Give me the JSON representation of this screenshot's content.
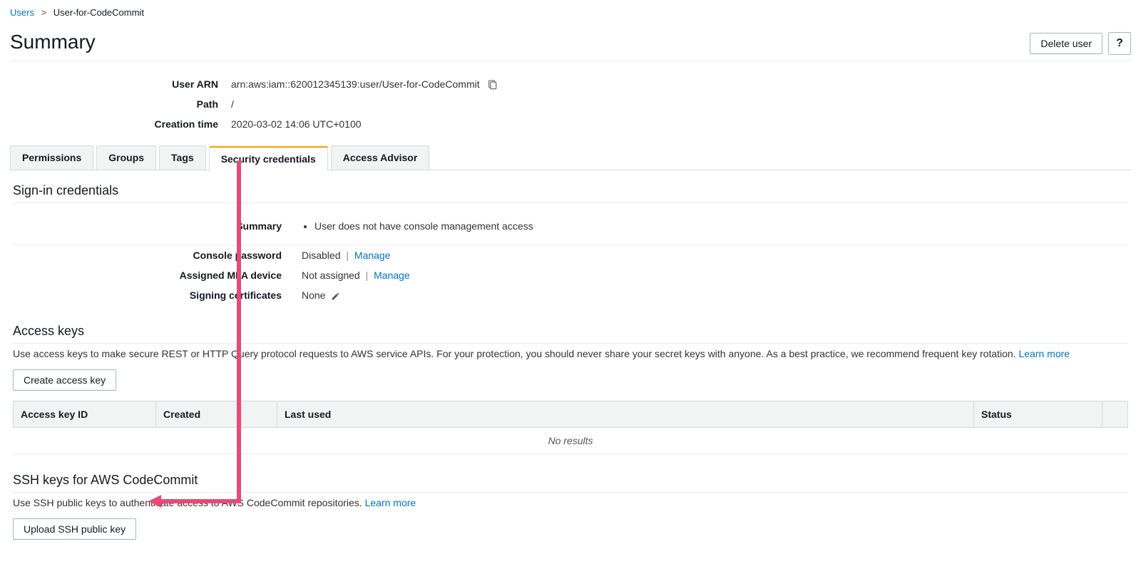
{
  "breadcrumb": {
    "root": "Users",
    "current": "User-for-CodeCommit"
  },
  "header": {
    "title": "Summary",
    "delete_label": "Delete user"
  },
  "meta": {
    "arn_label": "User ARN",
    "arn_value": "arn:aws:iam::620012345139:user/User-for-CodeCommit",
    "path_label": "Path",
    "path_value": "/",
    "created_label": "Creation time",
    "created_value": "2020-03-02 14:06 UTC+0100"
  },
  "tabs": {
    "permissions": "Permissions",
    "groups": "Groups",
    "tags": "Tags",
    "security": "Security credentials",
    "advisor": "Access Advisor"
  },
  "signin": {
    "heading": "Sign-in credentials",
    "summary_label": "Summary",
    "summary_bullet": "User does not have console management access",
    "console_pw_label": "Console password",
    "console_pw_value": "Disabled",
    "manage": "Manage",
    "mfa_label": "Assigned MFA device",
    "mfa_value": "Not assigned",
    "signing_label": "Signing certificates",
    "signing_value": "None"
  },
  "access_keys": {
    "heading": "Access keys",
    "desc": "Use access keys to make secure REST or HTTP Query protocol requests to AWS service APIs. For your protection, you should never share your secret keys with anyone. As a best practice, we recommend frequent key rotation. ",
    "learn_more": "Learn more",
    "create_btn": "Create access key",
    "col_id": "Access key ID",
    "col_created": "Created",
    "col_lastused": "Last used",
    "col_status": "Status",
    "no_results": "No results"
  },
  "ssh": {
    "heading": "SSH keys for AWS CodeCommit",
    "desc": "Use SSH public keys to authenticate access to AWS CodeCommit repositories. ",
    "learn_more": "Learn more",
    "upload_btn": "Upload SSH public key"
  }
}
